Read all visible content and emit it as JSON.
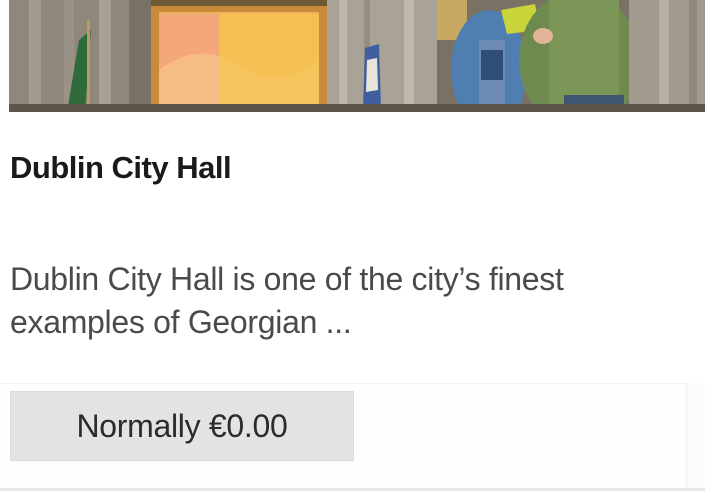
{
  "card": {
    "image_alt": "Visitors inside Dublin City Hall rotunda",
    "title": "Dublin City Hall",
    "description": "Dublin City Hall is one of the city’s finest examples of Georgian ...",
    "price_label": "Normally €0.00"
  },
  "colors": {
    "title_text": "#1a1a1a",
    "description_text": "#4a4a4a",
    "price_badge_bg": "#e3e3e3",
    "price_text": "#2b2b2b"
  }
}
